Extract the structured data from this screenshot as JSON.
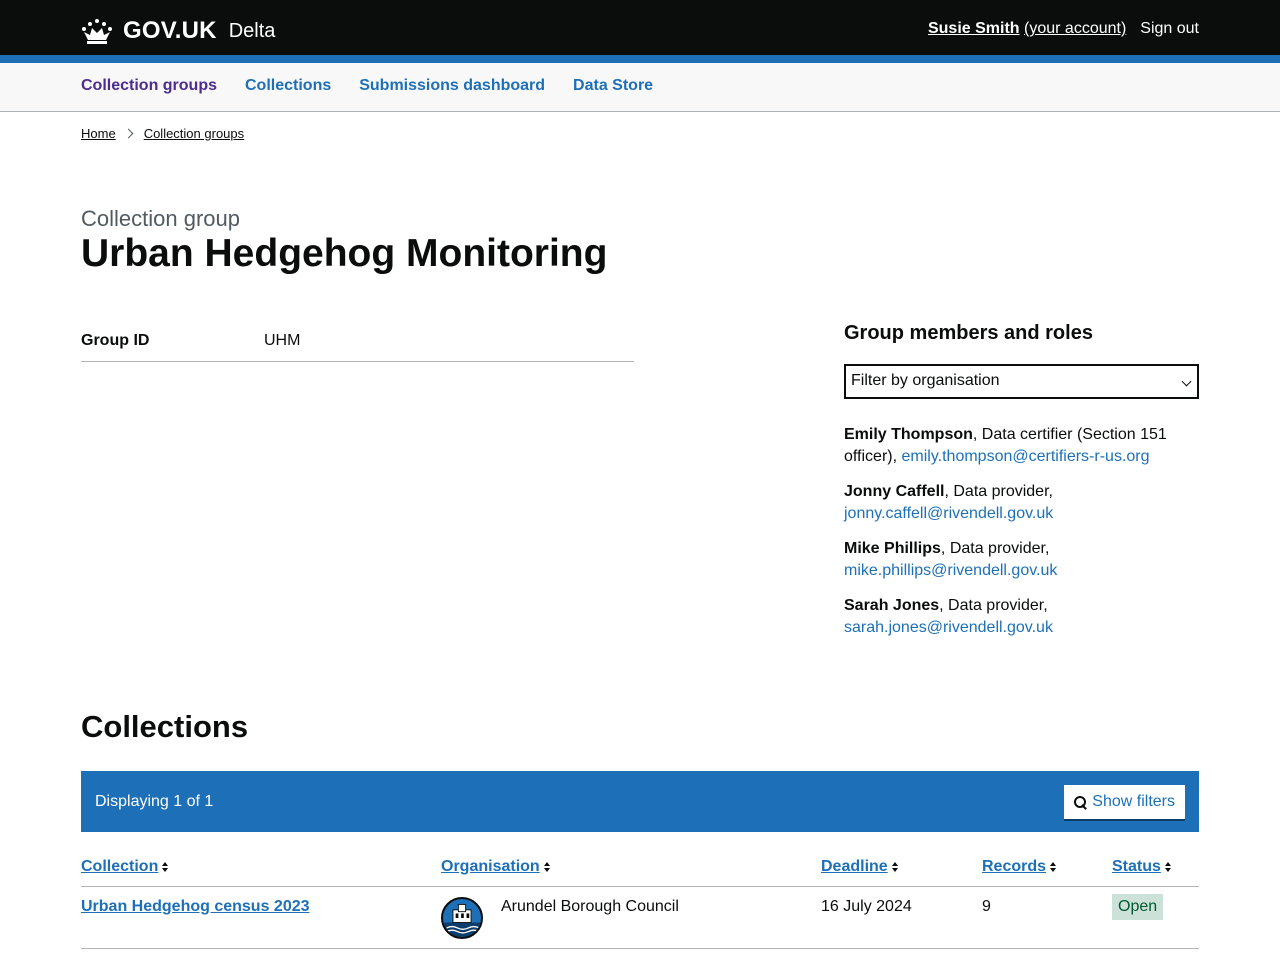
{
  "header": {
    "logo_text": "GOV.UK",
    "service_name": "Delta",
    "user_name": "Susie Smith",
    "account_link": "(your account)",
    "sign_out": "Sign out"
  },
  "nav": {
    "items": [
      {
        "label": "Collection groups",
        "active": true
      },
      {
        "label": "Collections"
      },
      {
        "label": "Submissions dashboard"
      },
      {
        "label": "Data Store"
      }
    ]
  },
  "breadcrumb": [
    "Home",
    "Collection groups"
  ],
  "page": {
    "caption": "Collection group",
    "title": "Urban Hedgehog Monitoring"
  },
  "summary": {
    "key": "Group ID",
    "value": "UHM"
  },
  "members": {
    "heading": "Group members and roles",
    "filter_placeholder": "Filter by organisation",
    "list": [
      {
        "name": "Emily Thompson",
        "role": ", Data certifier (Section 151 officer), ",
        "email": "emily.thompson@certifiers-r-us.org"
      },
      {
        "name": "Jonny Caffell",
        "role": ", Data provider, ",
        "email": "jonny.caffell@rivendell.gov.uk"
      },
      {
        "name": "Mike Phillips",
        "role": ", Data provider, ",
        "email": "mike.phillips@rivendell.gov.uk"
      },
      {
        "name": "Sarah Jones",
        "role": ", Data provider, ",
        "email": "sarah.jones@rivendell.gov.uk"
      }
    ]
  },
  "collections": {
    "heading": "Collections",
    "displaying": "Displaying 1 of 1",
    "show_filters": "Show filters",
    "columns": [
      "Collection",
      "Organisation",
      "Deadline",
      "Records",
      "Status"
    ],
    "rows": [
      {
        "collection": "Urban Hedgehog census 2023",
        "organisation": "Arundel Borough Council",
        "deadline": "16 July 2024",
        "records": "9",
        "status": "Open"
      }
    ]
  },
  "colors": {
    "header": "#0b0c0c",
    "brand_blue": "#1d70b8",
    "nav_active": "#4c2c92",
    "tag_green_bg": "#cce2d8",
    "tag_green_text": "#005a30"
  },
  "icons": [
    "crown-icon",
    "chevron-right-icon",
    "chevron-down-icon",
    "search-icon",
    "sort-icon",
    "council-crest-icon"
  ]
}
